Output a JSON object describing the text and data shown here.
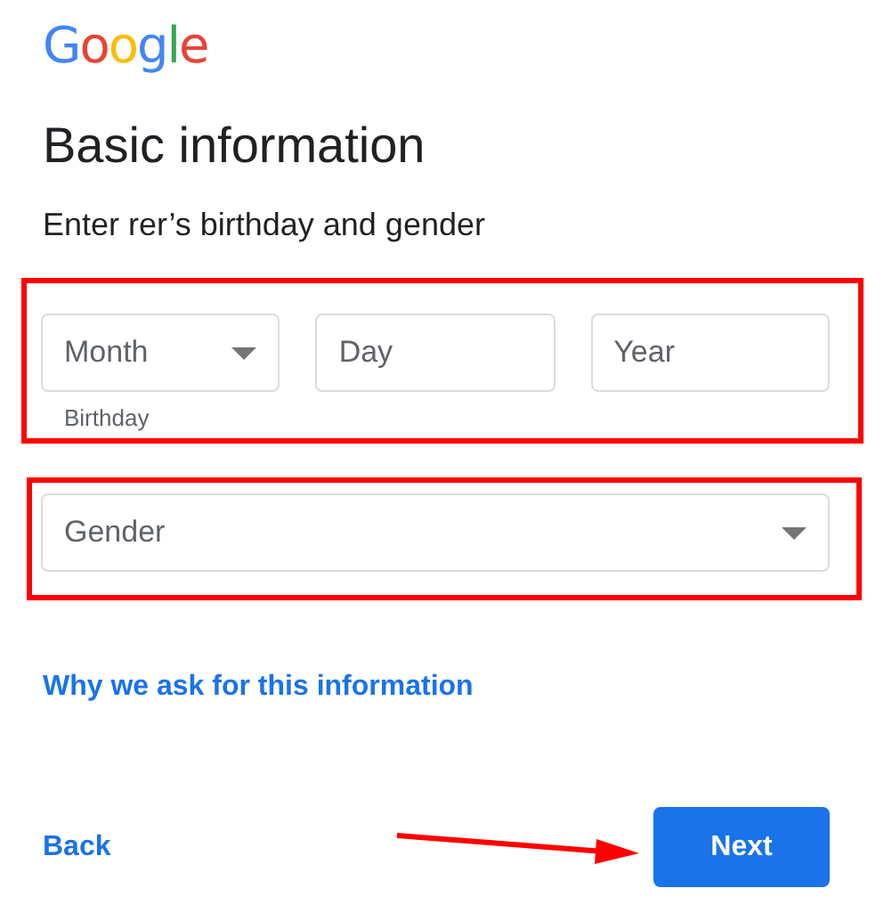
{
  "logo": "Google",
  "title": "Basic information",
  "subtitle": "Enter rer’s birthday and gender",
  "birthday": {
    "highlighted": true,
    "helper": "Birthday",
    "fields": [
      {
        "kind": "select",
        "placeholder": "Month"
      },
      {
        "kind": "text",
        "placeholder": "Day"
      },
      {
        "kind": "text",
        "placeholder": "Year"
      }
    ]
  },
  "gender": {
    "highlighted": true,
    "field": {
      "kind": "select",
      "placeholder": "Gender"
    }
  },
  "info_link": "Why we ask for this information",
  "back_link": "Back",
  "next_button": {
    "label": "Next",
    "pointed": true
  }
}
